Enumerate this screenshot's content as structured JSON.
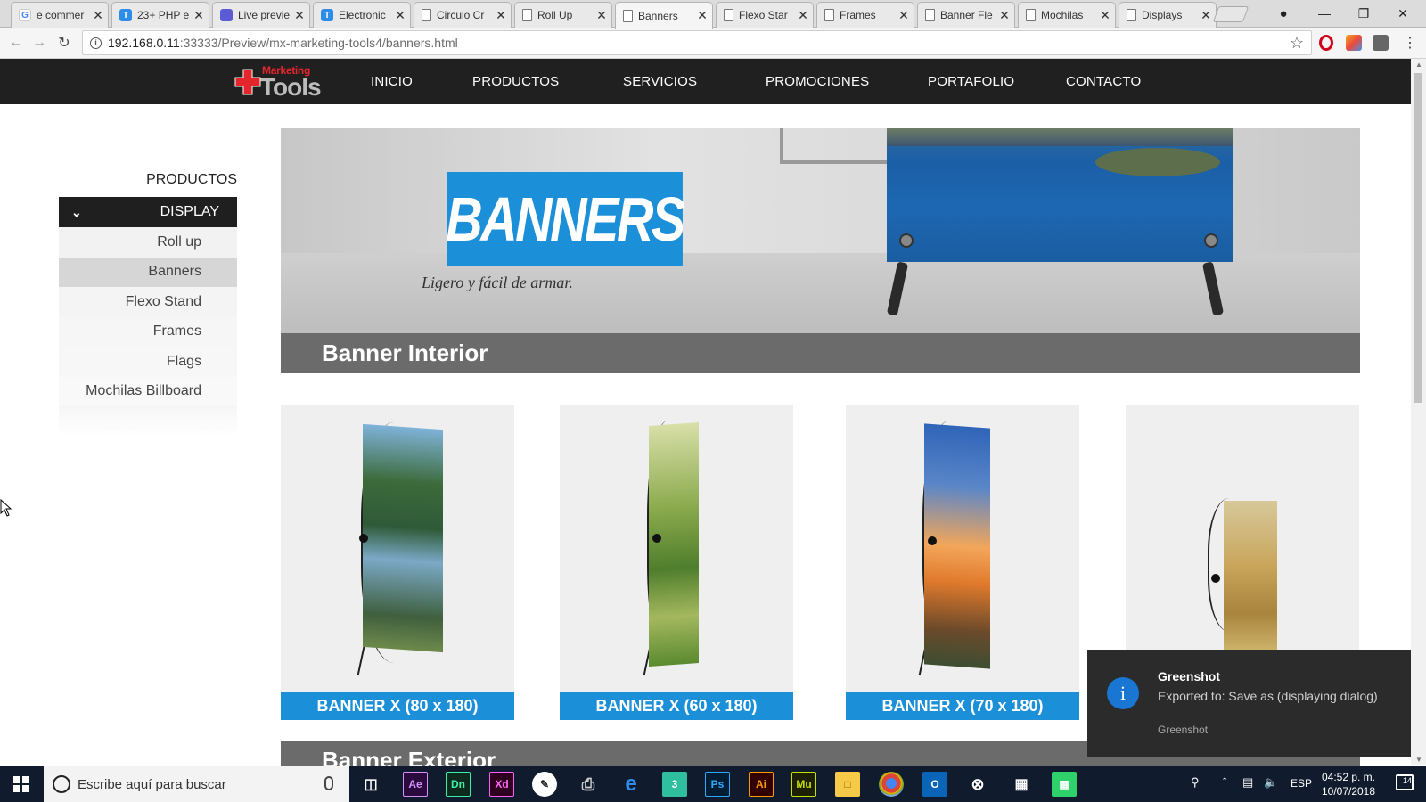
{
  "browser": {
    "tabs": [
      {
        "label": "e commer",
        "icon": "google-icon",
        "active": false
      },
      {
        "label": "23+ PHP e",
        "icon": "t-icon",
        "active": false
      },
      {
        "label": "Live previe",
        "icon": "live-preview-icon",
        "active": false
      },
      {
        "label": "Electronic",
        "icon": "t-icon",
        "active": false
      },
      {
        "label": "Circulo Cr",
        "icon": "doc-icon",
        "active": false
      },
      {
        "label": "Roll Up",
        "icon": "doc-icon",
        "active": false
      },
      {
        "label": "Banners",
        "icon": "doc-icon",
        "active": true
      },
      {
        "label": "Flexo Star",
        "icon": "doc-icon",
        "active": false
      },
      {
        "label": "Frames",
        "icon": "doc-icon",
        "active": false
      },
      {
        "label": "Banner Fle",
        "icon": "doc-icon",
        "active": false
      },
      {
        "label": "Mochilas",
        "icon": "doc-icon",
        "active": false
      },
      {
        "label": "Displays",
        "icon": "doc-icon",
        "active": false
      }
    ],
    "url_host": "192.168.0.11",
    "url_path": ":33333/Preview/mx-marketing-tools4/banners.html"
  },
  "site": {
    "logo_top": "Marketing",
    "logo_main": "Tools",
    "nav": [
      "INICIO",
      "PRODUCTOS",
      "SERVICIOS",
      "PROMOCIONES",
      "PORTAFOLIO",
      "CONTACTO"
    ]
  },
  "sidebar": {
    "title": "PRODUCTOS",
    "group": "DISPLAY",
    "items": [
      {
        "label": "Roll up",
        "selected": false
      },
      {
        "label": "Banners",
        "selected": true
      },
      {
        "label": "Flexo Stand",
        "selected": false
      },
      {
        "label": "Frames",
        "selected": false
      },
      {
        "label": "Flags",
        "selected": false
      },
      {
        "label": "Mochilas Billboard",
        "selected": false
      }
    ]
  },
  "hero": {
    "title": "BANNERS",
    "subtitle": "Ligero y fácil de armar."
  },
  "sections": {
    "interior": "Banner Interior",
    "exterior": "Banner Exterior"
  },
  "products": [
    {
      "label": "BANNER X (80 x 180)"
    },
    {
      "label": "BANNER X (60 x 180)"
    },
    {
      "label": "BANNER X (70 x 180)"
    },
    {
      "label": ""
    }
  ],
  "toast": {
    "title": "Greenshot",
    "body": "Exported to: Save as (displaying dialog)",
    "app": "Greenshot"
  },
  "taskbar": {
    "search_placeholder": "Escribe aquí para buscar",
    "language": "ESP",
    "time": "04:52 p. m.",
    "date": "10/07/2018",
    "notifications": "14"
  },
  "colors": {
    "accent_blue": "#1b8fd8",
    "header_dark": "#202020",
    "section_gray": "#6b6b6b"
  }
}
